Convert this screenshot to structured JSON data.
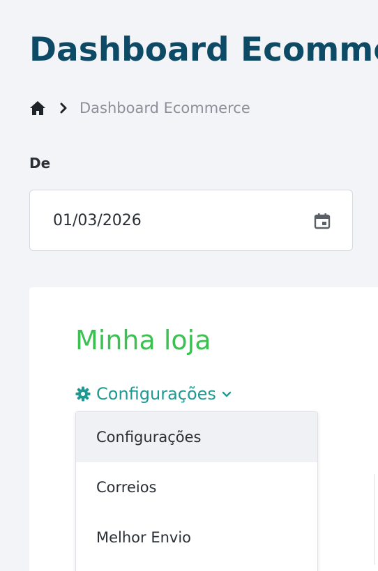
{
  "header": {
    "title": "Dashboard Ecommerce"
  },
  "breadcrumb": {
    "home_icon": "home-icon",
    "separator_icon": "chevron-right-icon",
    "current": "Dashboard Ecommerce"
  },
  "date_filter": {
    "label": "De",
    "value": "01/03/2026",
    "icon": "calendar-icon"
  },
  "store_card": {
    "title": "Minha loja",
    "settings": {
      "label": "Configurações",
      "icon": "gear-icon",
      "caret_icon": "chevron-down-icon",
      "menu_items": [
        {
          "label": "Configurações",
          "active": true
        },
        {
          "label": "Correios",
          "active": false
        },
        {
          "label": "Melhor Envio",
          "active": false
        }
      ]
    }
  },
  "colors": {
    "title": "#0d4a66",
    "breadcrumb_text": "#8b8f98",
    "store_title": "#3cc052",
    "settings_accent": "#1f9a93",
    "page_background": "#f3f4f8"
  }
}
